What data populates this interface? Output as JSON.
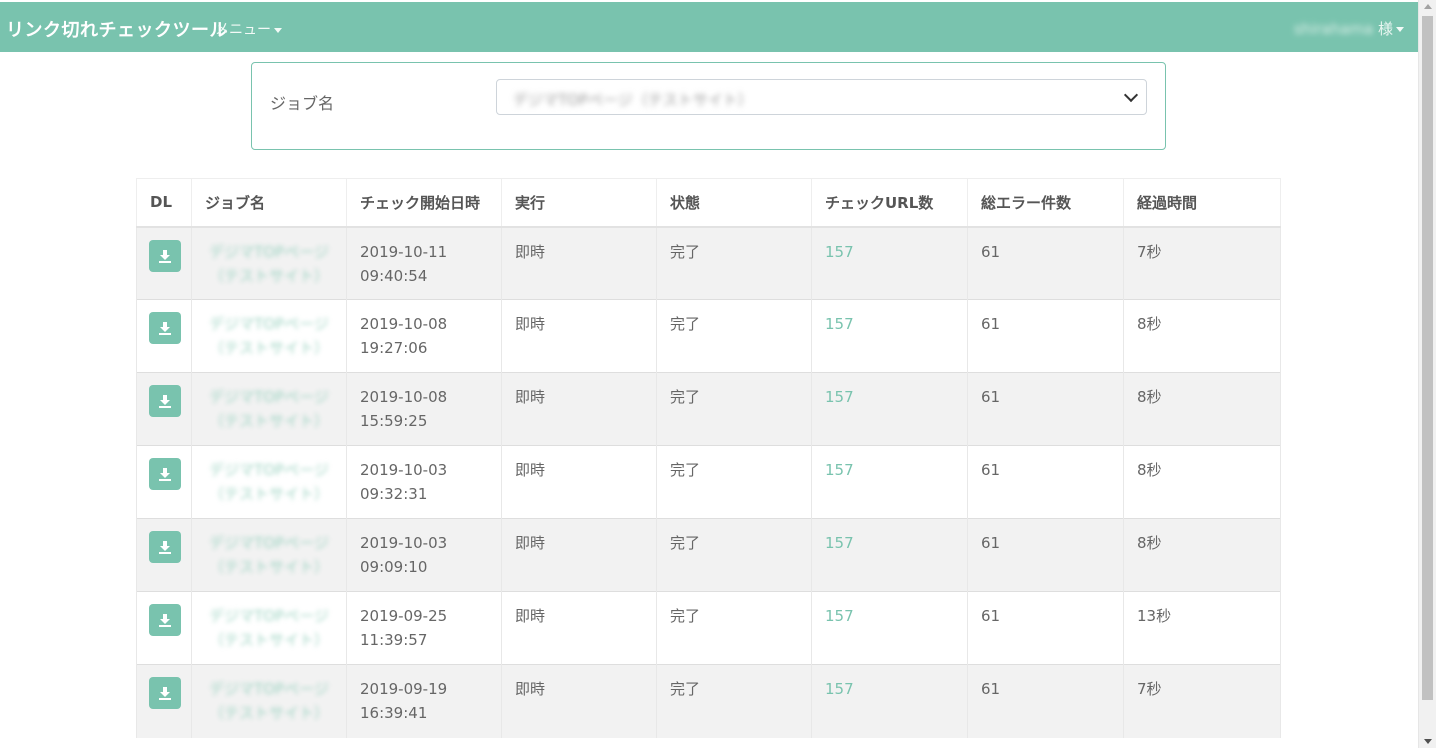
{
  "app": {
    "title": "リンク切れチェックツール",
    "menu_label": "メニュー",
    "user_name": "shirahama",
    "user_suffix": " 様"
  },
  "filter": {
    "label": "ジョブ名",
    "selected": "デジマTOPページ（テストサイト）"
  },
  "table": {
    "headers": [
      "DL",
      "ジョブ名",
      "チェック開始日時",
      "実行",
      "状態",
      "チェックURL数",
      "総エラー件数",
      "経過時間"
    ],
    "rows": [
      {
        "job_line1": "デジマTOPページ",
        "job_line2": "（テストサイト）",
        "date": "2019-10-11",
        "time": "09:40:54",
        "exec": "即時",
        "status": "完了",
        "urls": "157",
        "errors": "61",
        "elapsed": "7秒"
      },
      {
        "job_line1": "デジマTOPページ",
        "job_line2": "（テストサイト）",
        "date": "2019-10-08",
        "time": "19:27:06",
        "exec": "即時",
        "status": "完了",
        "urls": "157",
        "errors": "61",
        "elapsed": "8秒"
      },
      {
        "job_line1": "デジマTOPページ",
        "job_line2": "（テストサイト）",
        "date": "2019-10-08",
        "time": "15:59:25",
        "exec": "即時",
        "status": "完了",
        "urls": "157",
        "errors": "61",
        "elapsed": "8秒"
      },
      {
        "job_line1": "デジマTOPページ",
        "job_line2": "（テストサイト）",
        "date": "2019-10-03",
        "time": "09:32:31",
        "exec": "即時",
        "status": "完了",
        "urls": "157",
        "errors": "61",
        "elapsed": "8秒"
      },
      {
        "job_line1": "デジマTOPページ",
        "job_line2": "（テストサイト）",
        "date": "2019-10-03",
        "time": "09:09:10",
        "exec": "即時",
        "status": "完了",
        "urls": "157",
        "errors": "61",
        "elapsed": "8秒"
      },
      {
        "job_line1": "デジマTOPページ",
        "job_line2": "（テストサイト）",
        "date": "2019-09-25",
        "time": "11:39:57",
        "exec": "即時",
        "status": "完了",
        "urls": "157",
        "errors": "61",
        "elapsed": "13秒"
      },
      {
        "job_line1": "デジマTOPページ",
        "job_line2": "（テストサイト）",
        "date": "2019-09-19",
        "time": "16:39:41",
        "exec": "即時",
        "status": "完了",
        "urls": "157",
        "errors": "61",
        "elapsed": "7秒"
      }
    ]
  },
  "icons": {
    "download": "download-icon",
    "dropdown": "chevron-down-icon",
    "caret": "caret-down-icon"
  },
  "colors": {
    "accent": "#79c3ae",
    "row_alt": "#f2f2f2",
    "link": "#79c3ae"
  }
}
